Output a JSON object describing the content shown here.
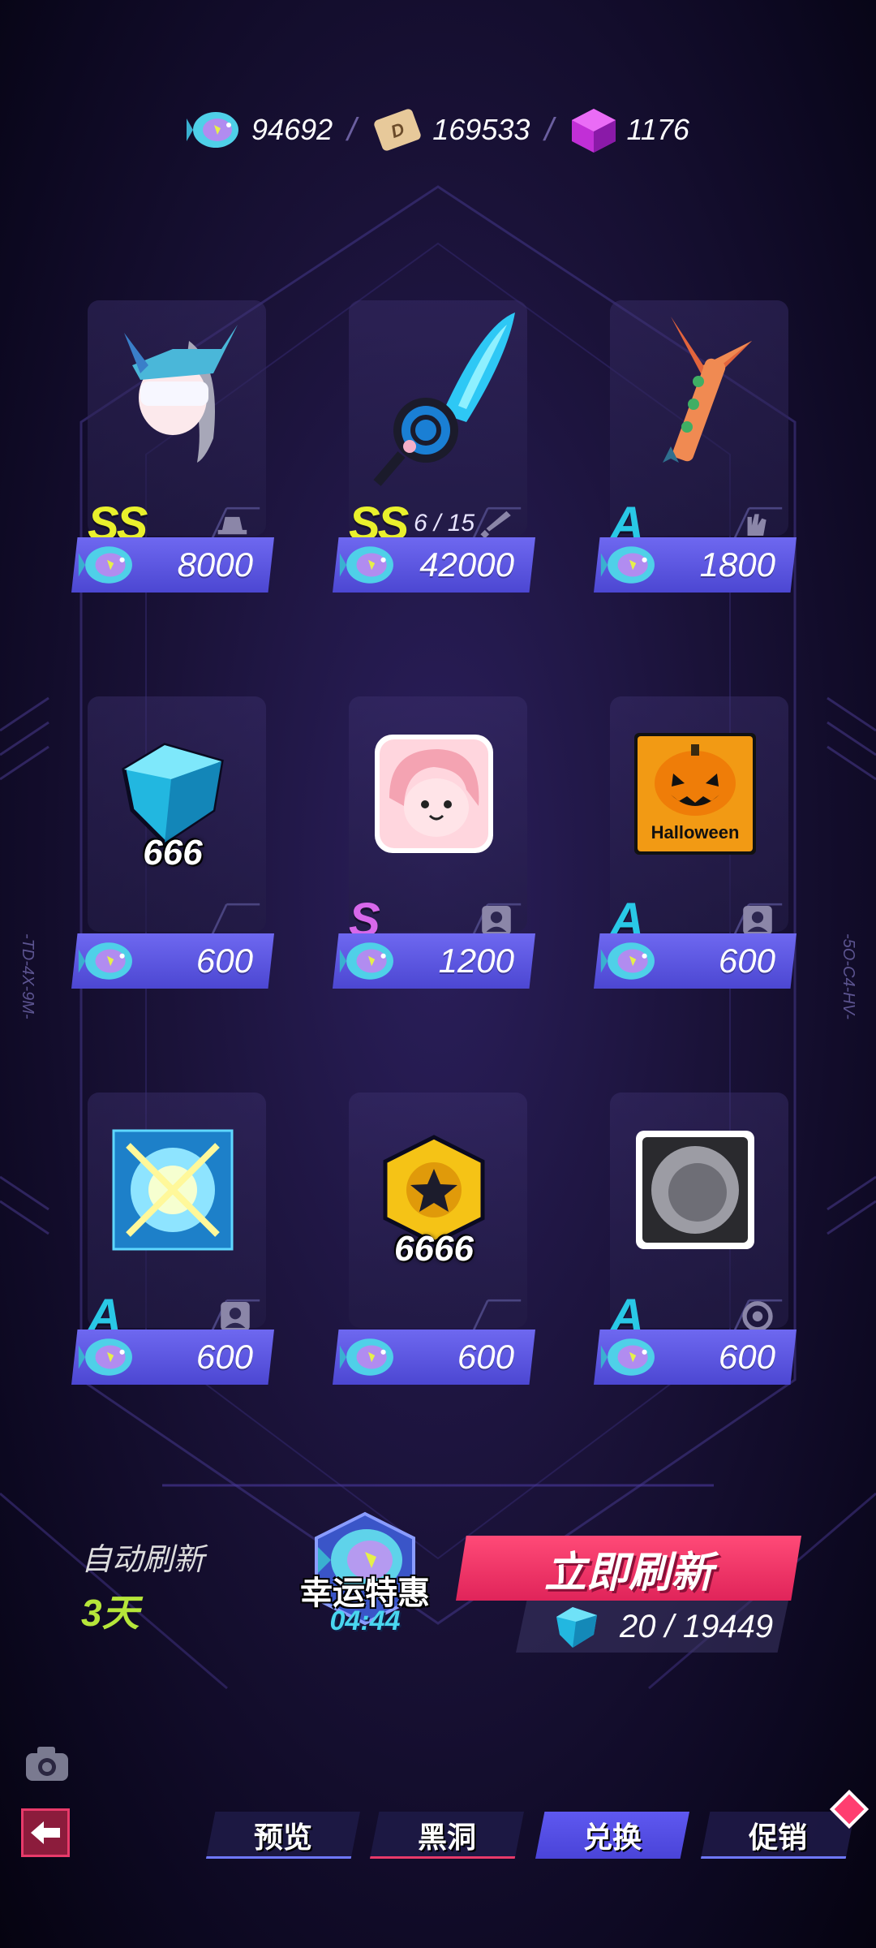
{
  "currencies": [
    {
      "icon": "fish-coin-icon",
      "value": "94692"
    },
    {
      "icon": "d-ticket-icon",
      "value": "169533"
    },
    {
      "icon": "purple-cube-icon",
      "value": "1176"
    }
  ],
  "items": [
    {
      "name": "ss-helmet-item",
      "rank": "SS",
      "rank_class": "ss",
      "category_icon": "hat-icon",
      "price": "8000",
      "stock": "",
      "quantity": ""
    },
    {
      "name": "ss-sword-item",
      "rank": "SS",
      "rank_class": "ss",
      "category_icon": "sword-icon",
      "price": "42000",
      "stock": "6 / 15",
      "quantity": ""
    },
    {
      "name": "a-axe-item",
      "rank": "A",
      "rank_class": "a",
      "category_icon": "glove-icon",
      "price": "1800",
      "stock": "",
      "quantity": ""
    },
    {
      "name": "gem-bundle-item",
      "rank": "",
      "rank_class": "",
      "category_icon": "",
      "price": "600",
      "stock": "",
      "quantity": "666"
    },
    {
      "name": "pink-avatar-item",
      "rank": "S",
      "rank_class": "s",
      "category_icon": "avatar-icon",
      "price": "1200",
      "stock": "",
      "quantity": ""
    },
    {
      "name": "halloween-avatar-item",
      "rank": "A",
      "rank_class": "a",
      "category_icon": "avatar-icon",
      "price": "600",
      "stock": "",
      "quantity": ""
    },
    {
      "name": "glow-frame-item",
      "rank": "A",
      "rank_class": "a",
      "category_icon": "avatar-icon",
      "price": "600",
      "stock": "",
      "quantity": ""
    },
    {
      "name": "star-coin-item",
      "rank": "",
      "rank_class": "",
      "category_icon": "",
      "price": "600",
      "stock": "",
      "quantity": "6666"
    },
    {
      "name": "sphere-item",
      "rank": "A",
      "rank_class": "a",
      "category_icon": "target-icon",
      "price": "600",
      "stock": "",
      "quantity": ""
    }
  ],
  "halloween_text": "Halloween",
  "refresh": {
    "auto_label": "自动刷新",
    "auto_days": "3天",
    "lucky_title": "幸运特惠",
    "lucky_timer": "04:44",
    "button_label": "立即刷新",
    "cost": "20 / 19449"
  },
  "side_codes": {
    "left": "-TD-4X-9M-",
    "right": "-5O-C4-HV-"
  },
  "tabs": [
    "预览",
    "黑洞",
    "兑换",
    "促销"
  ],
  "active_tab": "兑换",
  "colors": {
    "accent": "#5e58f0",
    "refresh": "#ff4a77",
    "rank_ss": "#e9f02c",
    "rank_s": "#d768ea",
    "rank_a": "#29c8e6"
  }
}
